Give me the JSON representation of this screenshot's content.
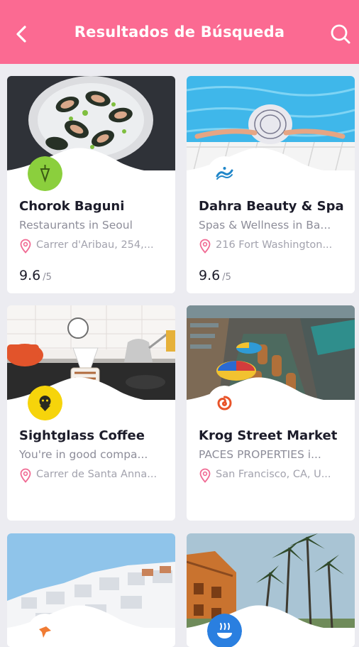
{
  "header": {
    "title": "Resultados de Búsqueda",
    "back_icon": "chevron-left-icon",
    "search_icon": "search-icon",
    "bg_color": "#fb6a92"
  },
  "places": [
    {
      "name": "Chorok Baguni",
      "category": "Restaurants in Seoul",
      "address": "Carrer d'Aribau, 254,...",
      "rating": "9.6",
      "rating_scale": "/5",
      "logo_color": "#8bcf3d"
    },
    {
      "name": "Dahra Beauty & Spa",
      "category": "Spas & Wellness in Ba...",
      "address": "216 Fort Washington...",
      "rating": "9.6",
      "rating_scale": "/5",
      "logo_color": "#ffffff"
    },
    {
      "name": "Sightglass Coffee",
      "category": "You're in good compa...",
      "address": "Carrer de Santa Anna...",
      "logo_color": "#f6d40b"
    },
    {
      "name": "Krog Street Market",
      "category": "PACES PROPERTIES i...",
      "address": "San Francisco, CA, U...",
      "logo_color": "#ffffff"
    },
    {
      "logo_color": "#ffffff"
    },
    {
      "logo_color": "#2a7fe0"
    }
  ],
  "icons": {
    "pin": "location-pin-icon"
  }
}
